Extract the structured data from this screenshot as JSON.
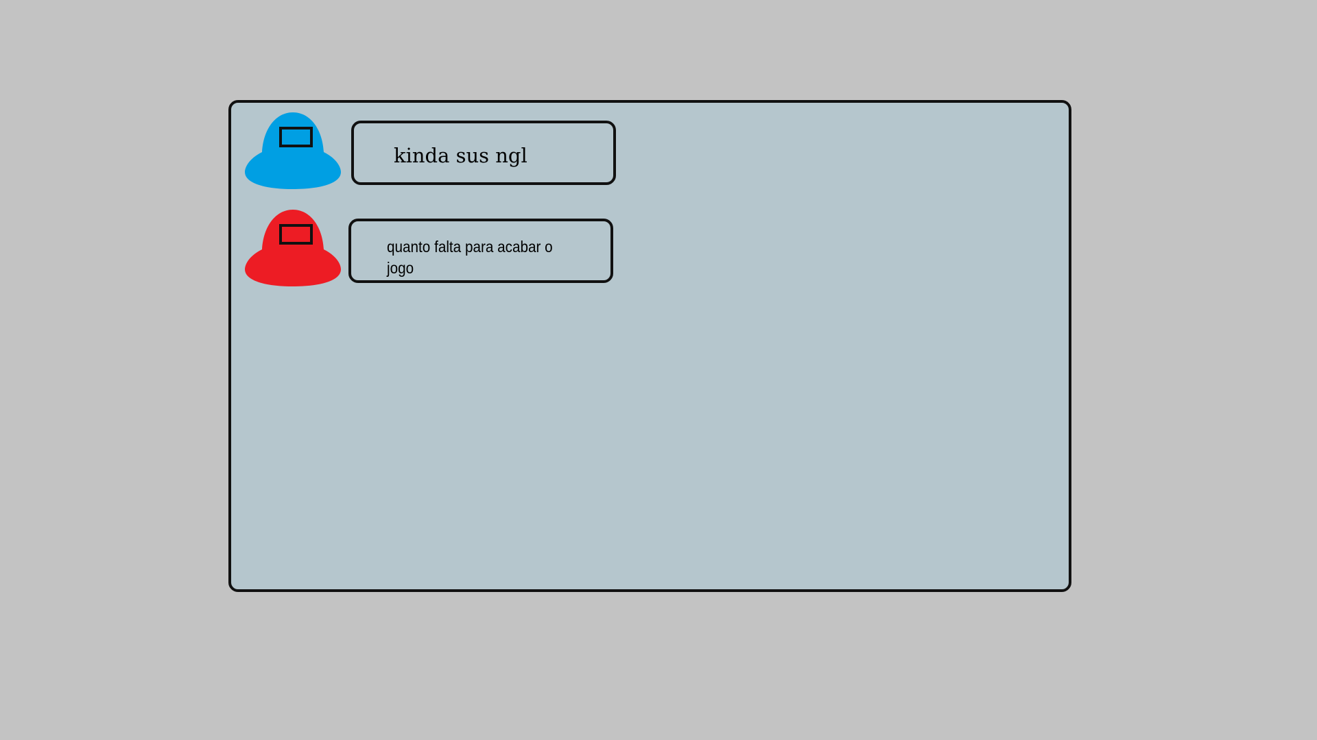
{
  "chat": {
    "messages": [
      {
        "player_icon": "crewmate-icon",
        "player_color": "#009fe3",
        "text": "kinda sus ngl"
      },
      {
        "player_icon": "crewmate-icon",
        "player_color": "#ed1c24",
        "text": "quanto falta para acabar o jogo"
      }
    ]
  },
  "colors": {
    "background": "#c3c3c3",
    "panel": "#b5c6cd",
    "outline": "#111111"
  }
}
